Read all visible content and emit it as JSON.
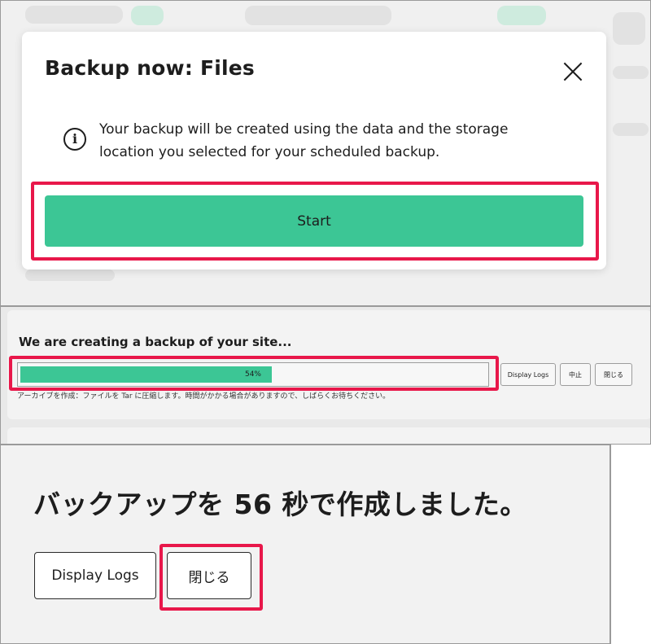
{
  "modal": {
    "title": "Backup now: Files",
    "info_text": "Your backup will be created using the data and the storage location you selected for your scheduled backup.",
    "start_label": "Start"
  },
  "progress_panel": {
    "title": "We are creating a backup of your site...",
    "progress_percent": 54,
    "progress_label": "54%",
    "display_logs_label": "Display Logs",
    "abort_label": "中止",
    "close_label": "閉じる",
    "status_text": "アーカイブを作成：ファイルを Tar に圧縮します。時間がかかる場合がありますので、しばらくお待ちください。"
  },
  "complete_panel": {
    "heading": "バックアップを 56 秒で作成しました。",
    "display_logs_label": "Display Logs",
    "close_label": "閉じる"
  },
  "colors": {
    "accent_green": "#3cc695",
    "highlight_red": "#e8174a"
  }
}
